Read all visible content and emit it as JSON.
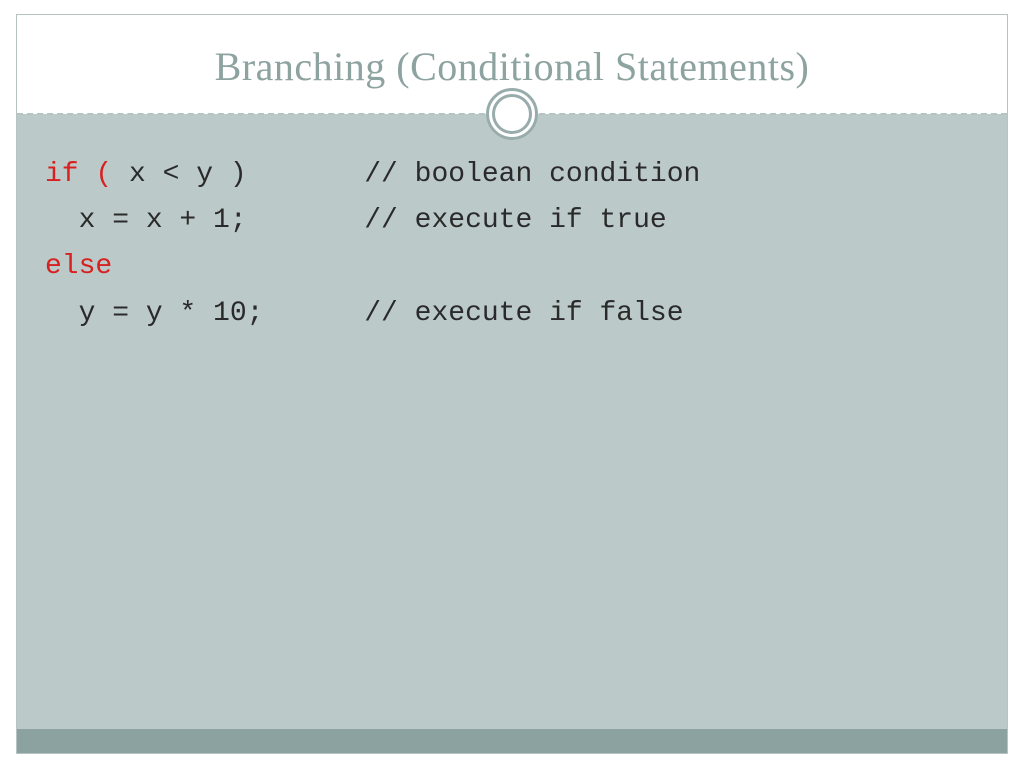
{
  "slide": {
    "title": "Branching (Conditional  Statements)",
    "code": {
      "line1_keyword": "if ( ",
      "line1_rest": "x < y )       // boolean condition",
      "line2": "  x = x + 1;       // execute if true",
      "line3_keyword": "else",
      "line4": "  y = y * 10;      // execute if false"
    }
  }
}
